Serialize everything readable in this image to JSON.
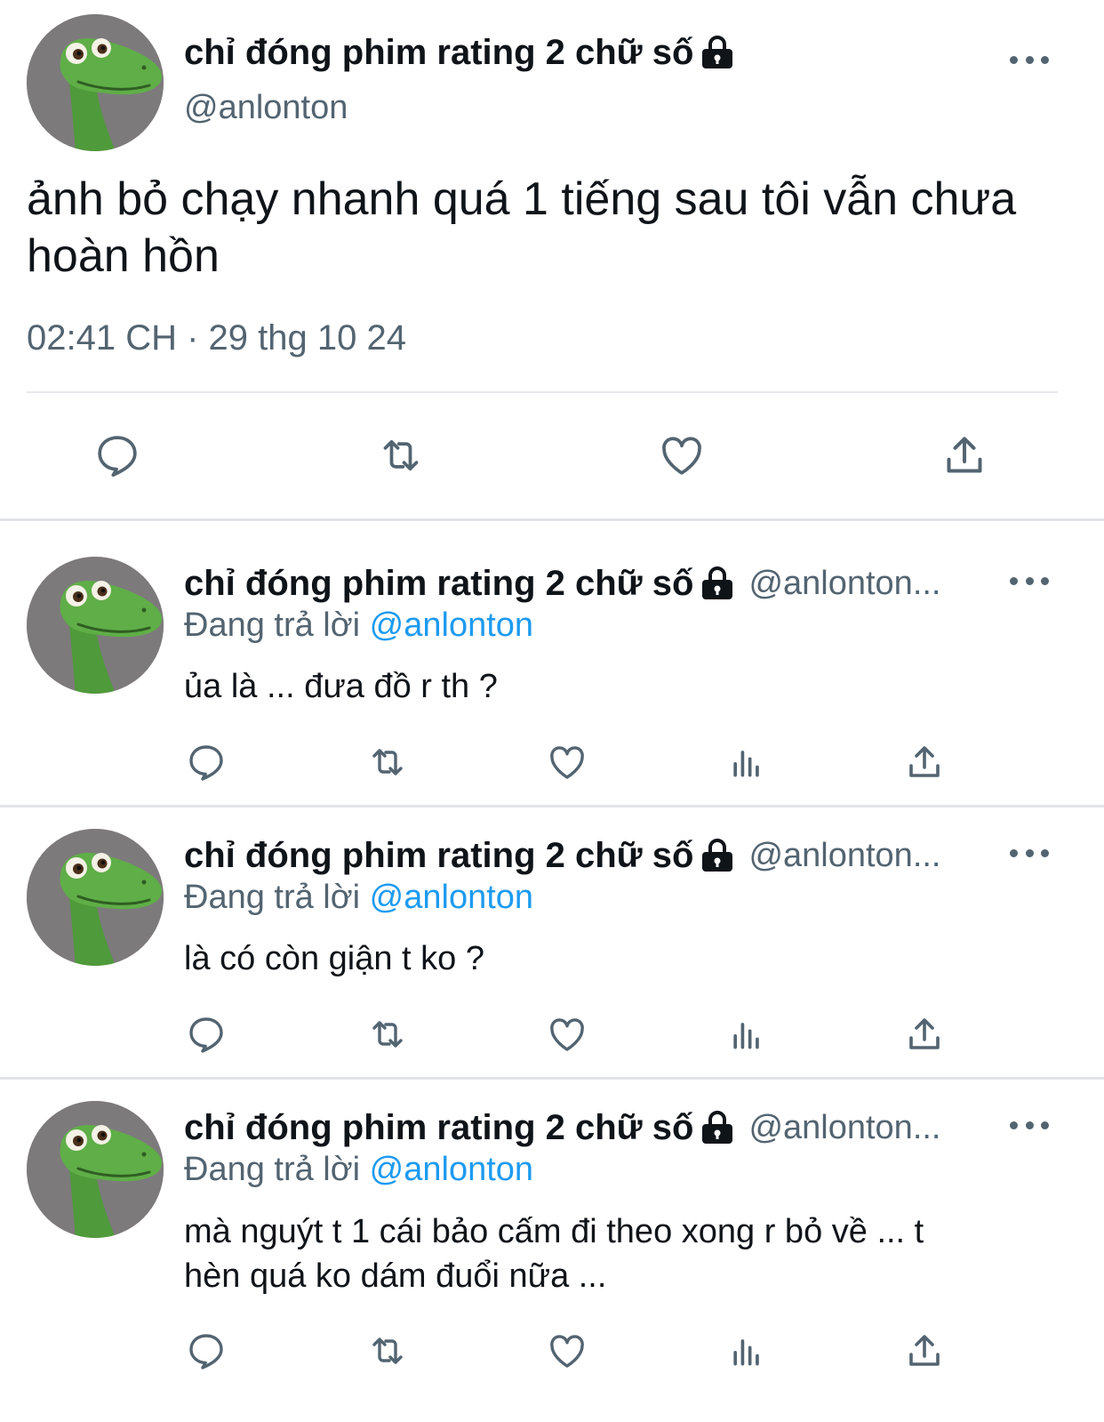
{
  "main_tweet": {
    "display_name": "chỉ đóng phim rating 2 chữ số",
    "handle": "@anlonton",
    "text_line1": "ảnh bỏ chạy nhanh quá 1 tiếng sau tôi vẫn chưa",
    "text_line2": "hoàn hồn",
    "timestamp": "02:41 CH · 29 thg 10 24"
  },
  "replies": [
    {
      "display_name": "chỉ đóng phim rating 2 chữ số",
      "handle": "@anlonton...",
      "replying_label": "Đang trả lời",
      "replying_to": "@anlonton",
      "text_line1": "ủa là ... đưa đồ r th ?",
      "text_line2": ""
    },
    {
      "display_name": "chỉ đóng phim rating 2 chữ số",
      "handle": "@anlonton...",
      "replying_label": "Đang trả lời",
      "replying_to": "@anlonton",
      "text_line1": "là có còn giận t ko ?",
      "text_line2": ""
    },
    {
      "display_name": "chỉ đóng phim rating 2 chữ số",
      "handle": "@anlonton...",
      "replying_label": "Đang trả lời",
      "replying_to": "@anlonton",
      "text_line1": "mà nguýt t 1 cái bảo cấm đi theo xong r bỏ về ... t",
      "text_line2": "hèn quá ko dám đuổi nữa ..."
    }
  ],
  "icons": {
    "reply": "reply-bubble-icon",
    "retweet": "retweet-icon",
    "like": "heart-icon",
    "views": "views-bar-icon",
    "share": "share-upload-icon",
    "more": "more-dots-icon",
    "lock": "lock-icon"
  },
  "colors": {
    "text": "#0f1419",
    "secondary": "#536471",
    "mention": "#1d9bf0",
    "divider": "#e6e9ec",
    "avatar_bg": "#7d7a7c"
  }
}
